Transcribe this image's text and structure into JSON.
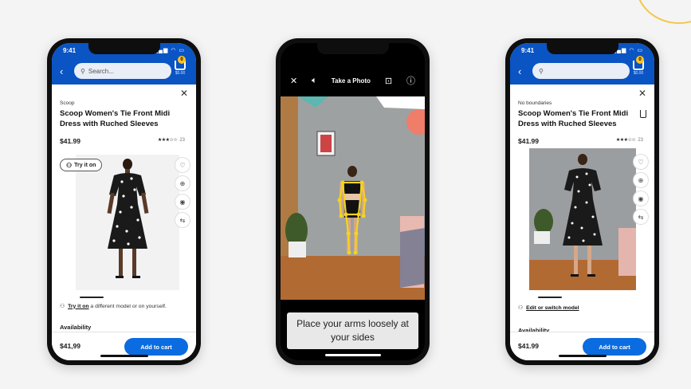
{
  "colors": {
    "walmart_blue": "#0a54c4",
    "button_blue": "#0a6ce0",
    "accent_yellow": "#ffc220"
  },
  "left_phone": {
    "time": "9:41",
    "search_placeholder": "Search...",
    "close_icon": "close-icon",
    "brand": "Scoop",
    "title": "Scoop Women's Tie Front Midi Dress with Ruched Sleeves",
    "price": "$41.99",
    "rating_stars": "★★★☆☆",
    "review_count": "23",
    "tryon_pill": "Try it on",
    "tryon_link": "Try it on",
    "tryon_text": "a different model or on yourself.",
    "availability": "Availability",
    "footer_price": "$41,99",
    "add_to_cart": "Add to cart"
  },
  "camera_phone": {
    "title": "Take a Photo",
    "instruction": "Place your arms loosely at your sides"
  },
  "right_phone": {
    "time": "9:41",
    "brand": "No boundaries",
    "title": "Scoop Women's Tie Front Midi Dress with Ruched Sleeves",
    "price": "$41.99",
    "rating_stars": "★★★☆☆",
    "review_count": "23",
    "edit_link": "Edit or switch model",
    "availability": "Availability",
    "footer_price": "$41.99",
    "add_to_cart": "Add to cart"
  }
}
